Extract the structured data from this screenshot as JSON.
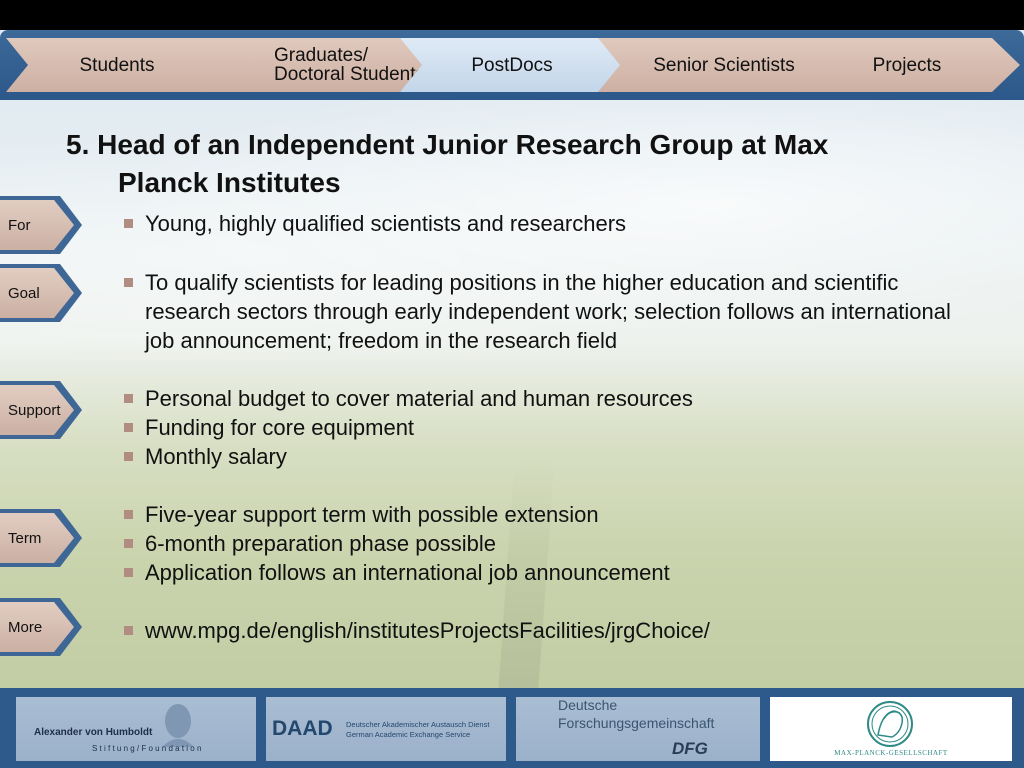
{
  "nav": {
    "tabs": [
      {
        "label": "Students",
        "active": false
      },
      {
        "label_line1": "Graduates/",
        "label_line2": "Doctoral Students",
        "active": false
      },
      {
        "label": "PostDocs",
        "active": true
      },
      {
        "label": "Senior Scientists",
        "active": false
      },
      {
        "label": "Projects",
        "active": false
      }
    ]
  },
  "title": {
    "number": "5.",
    "line1": "Head of an Independent Junior Research Group at Max",
    "line2": "Planck Institutes"
  },
  "side_tabs": [
    "For",
    "Goal",
    "Support",
    "Term",
    "More"
  ],
  "bullets": [
    "Young, highly qualified scientists and researchers",
    "To qualify scientists for leading positions in the higher education and scientific research sectors through early independent work; selection follows an international job announcement; freedom in the research field",
    "Personal budget to cover material and human resources",
    "Funding for core equipment",
    "Monthly salary",
    "Five-year support term with possible extension",
    "6-month preparation phase possible",
    "Application follows an international job announcement",
    "www.mpg.de/english/institutesProjectsFacilities/jrgChoice/"
  ],
  "footer": {
    "humboldt": {
      "name": "Alexander von Humboldt",
      "sub": "S t i f t u n g / F o u n d a t i o n"
    },
    "daad": {
      "abbr": "DAAD",
      "line1": "Deutscher Akademischer Austausch Dienst",
      "line2": "German Academic Exchange Service"
    },
    "dfg": {
      "line1": "Deutsche",
      "line2": "Forschungsgemeinschaft",
      "abbr": "DFG"
    },
    "mpg": {
      "name": "MAX-PLANCK-GESELLSCHAFT"
    }
  },
  "colors": {
    "nav_bar": "#2c578a",
    "tab_normal": "#cdb0a3",
    "tab_active": "#c3d6ea",
    "bullet": "#b08d80",
    "footer": "#2d5a8a"
  }
}
